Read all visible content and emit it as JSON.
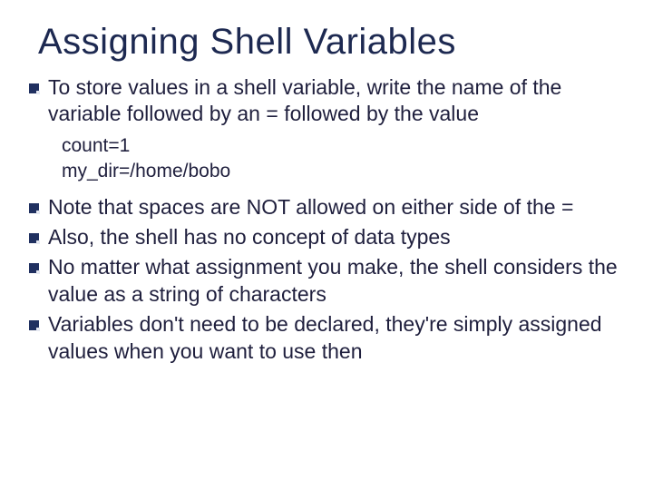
{
  "title": "Assigning Shell Variables",
  "bullets": {
    "b1": "To store values in a shell variable, write the name of the variable followed by an = followed by the value",
    "b2": "Note that spaces are NOT allowed on either side of the =",
    "b3": "Also, the shell has no concept of data types",
    "b4": "No matter what assignment you make, the shell considers the value as a string of characters",
    "b5": "Variables don't need to be declared, they're simply assigned values when you want to use then"
  },
  "code": {
    "line1": "count=1",
    "line2": "my_dir=/home/bobo"
  }
}
